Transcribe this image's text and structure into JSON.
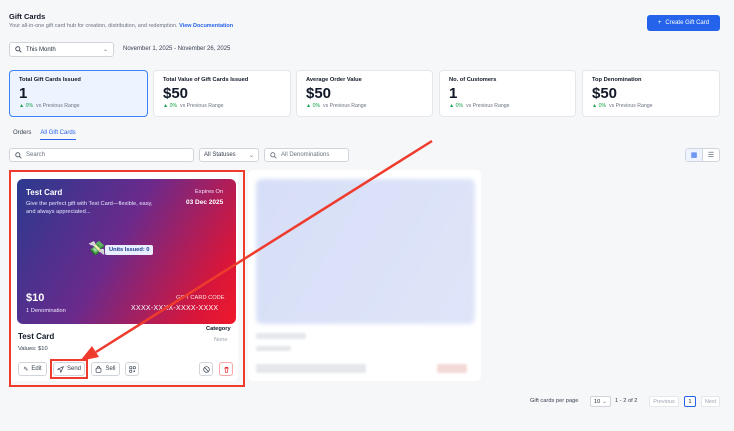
{
  "header": {
    "title": "Gift Cards",
    "subtitle": "Your all-in-one gift card hub for creation, distribution, and redemption.",
    "doc_link": "View Documentation",
    "create_button": "Create Gift Card"
  },
  "filters": {
    "range_label": "This Month",
    "date_range": "November 1, 2025 - November 26, 2025",
    "search_placeholder": "Search",
    "status_value": "All Statuses",
    "denom_placeholder": "All Denominations"
  },
  "stats": [
    {
      "label": "Total Gift Cards Issued",
      "value": "1",
      "change": "0%",
      "compare": "vs Previous Range"
    },
    {
      "label": "Total Value of Gift Cards Issued",
      "value": "$50",
      "change": "0%",
      "compare": "vs Previous Range"
    },
    {
      "label": "Average Order Value",
      "value": "$50",
      "change": "0%",
      "compare": "vs Previous Range"
    },
    {
      "label": "No. of Customers",
      "value": "1",
      "change": "0%",
      "compare": "vs Previous Range"
    },
    {
      "label": "Top Denomination",
      "value": "$50",
      "change": "0%",
      "compare": "vs Previous Range"
    }
  ],
  "tabs": [
    "Orders",
    "All Gift Cards"
  ],
  "card": {
    "name": "Test Card",
    "description": "Give the perfect gift with Test Card—flexible, easy, and always appreciated...",
    "expires_label": "Expires On",
    "expires_value": "03 Dec 2025",
    "units_issued": "Units Issued: 0",
    "price": "$10",
    "denominations": "1 Denomination",
    "code_label": "GIFT CARD CODE",
    "code_value": "XXXX-XXXX-XXXX-XXXX",
    "title": "Test Card",
    "values": "Values: $10",
    "category_label": "Category",
    "category_value": "None",
    "edit_label": "Edit",
    "send_label": "Send",
    "sell_label": "Sell"
  },
  "pagination": {
    "per_page_label": "Gift cards per page",
    "per_page_value": "10",
    "range": "1 - 2 of 2",
    "previous": "Previous",
    "current": "1",
    "next": "Next"
  },
  "colors": {
    "accent": "#2563eb",
    "annotation_red": "#ef3b2d",
    "positive": "#16a34a"
  }
}
